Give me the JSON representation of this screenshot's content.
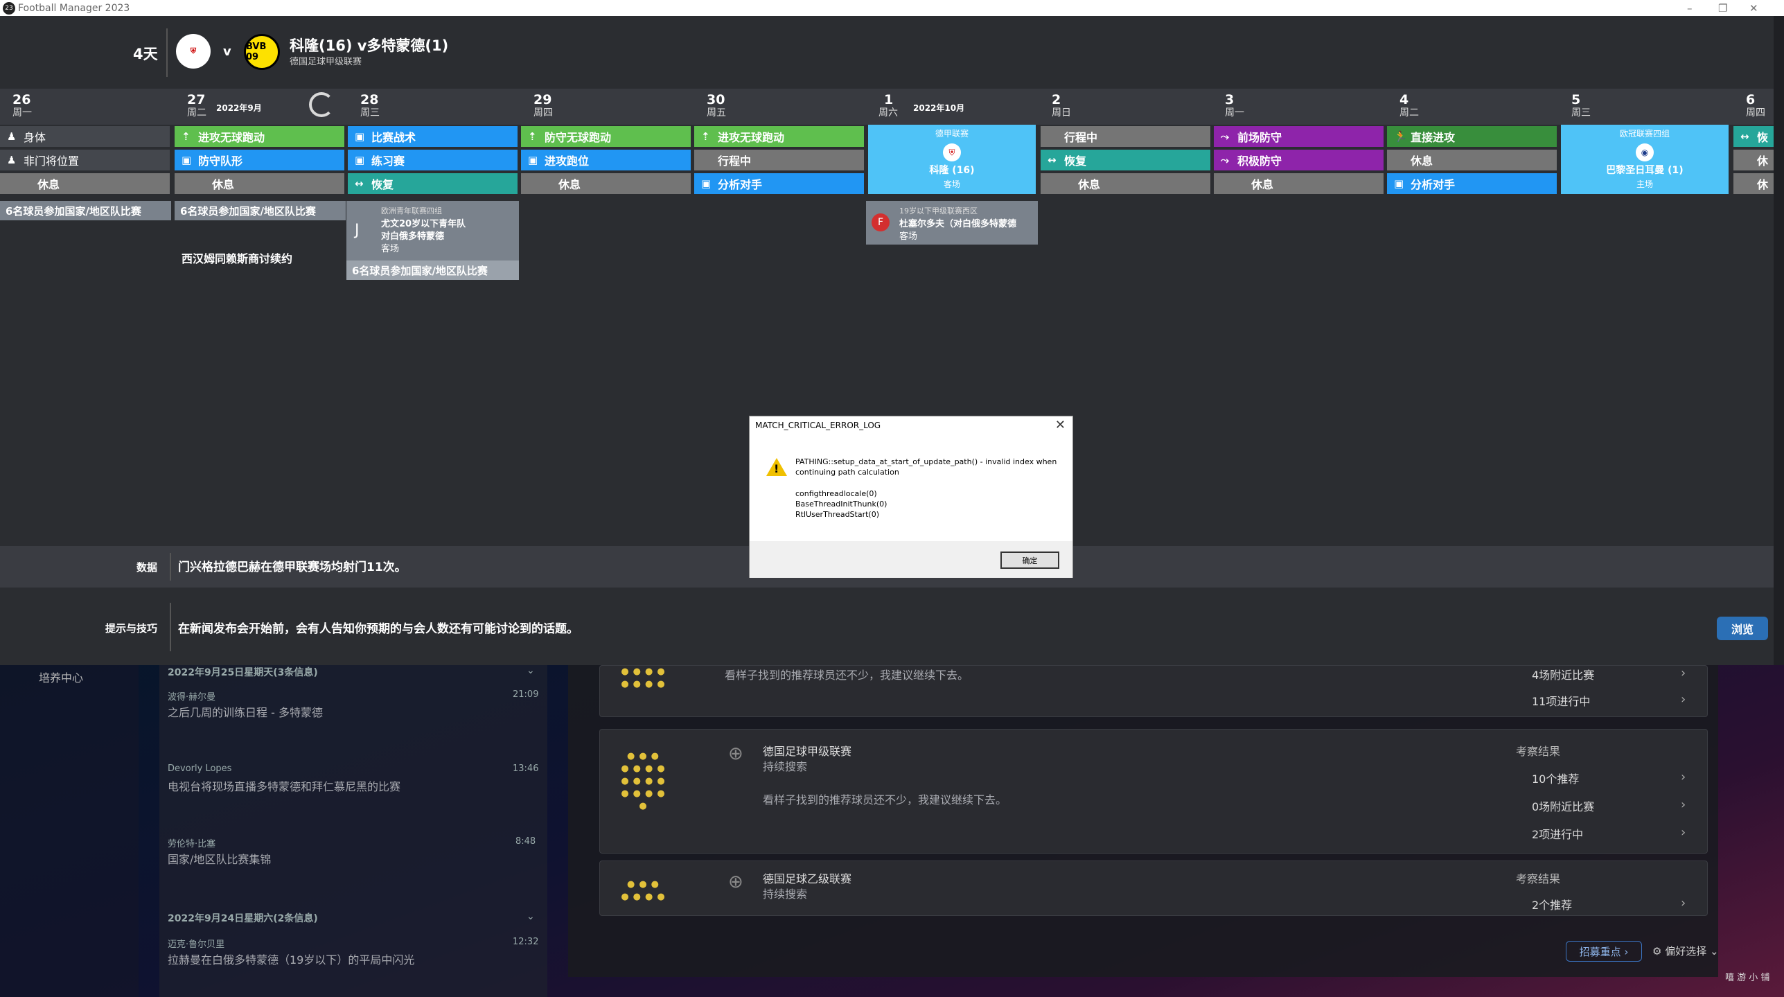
{
  "window": {
    "title": "Football Manager 2023",
    "logo": "23",
    "controls": [
      "–",
      "❐",
      "✕"
    ]
  },
  "match": {
    "days": "4天",
    "vs": "v",
    "title": "科隆(16) v多特蒙德(1)",
    "competition": "德国足球甲级联赛",
    "home_crest": "koln-crest",
    "away_crest": "bvb-crest",
    "away_crest_text": "BVB\n09"
  },
  "calendar": {
    "days": [
      {
        "num": "26",
        "wd": "周一"
      },
      {
        "num": "27",
        "wd": "周二",
        "month": "2022年9月"
      },
      {
        "num": "28",
        "wd": "周三"
      },
      {
        "num": "29",
        "wd": "周四"
      },
      {
        "num": "30",
        "wd": "周五"
      },
      {
        "num": "1",
        "wd": "周六",
        "month": "2022年10月"
      },
      {
        "num": "2",
        "wd": "周日"
      },
      {
        "num": "3",
        "wd": "周一"
      },
      {
        "num": "4",
        "wd": "周二"
      },
      {
        "num": "5",
        "wd": "周三"
      },
      {
        "num": "6",
        "wd": "周四"
      }
    ],
    "sessions": [
      [
        {
          "icon": "person-icon",
          "label": "身体",
          "color": "d"
        },
        {
          "icon": "person-icon",
          "label": "非门将位置",
          "color": "d"
        },
        {
          "icon": "",
          "label": "休息",
          "color": "r"
        }
      ],
      [
        {
          "icon": "arrow-up-icon",
          "label": "进攻无球跑动",
          "color": "g"
        },
        {
          "icon": "board-icon",
          "label": "防守队形",
          "color": "b"
        },
        {
          "icon": "",
          "label": "休息",
          "color": "r"
        }
      ],
      [
        {
          "icon": "board-icon",
          "label": "比赛战术",
          "color": "b"
        },
        {
          "icon": "board-icon",
          "label": "练习赛",
          "color": "b"
        },
        {
          "icon": "arrows-icon",
          "label": "恢复",
          "color": "t"
        }
      ],
      [
        {
          "icon": "arrow-up-icon",
          "label": "防守无球跑动",
          "color": "g"
        },
        {
          "icon": "board-icon",
          "label": "进攻跑位",
          "color": "b"
        },
        {
          "icon": "",
          "label": "休息",
          "color": "r"
        }
      ],
      [
        {
          "icon": "arrow-up-icon",
          "label": "进攻无球跑动",
          "color": "g"
        },
        {
          "icon": "",
          "label": "行程中",
          "color": "r"
        },
        {
          "icon": "board-icon",
          "label": "分析对手",
          "color": "b"
        }
      ],
      null,
      [
        {
          "icon": "",
          "label": "行程中",
          "color": "r"
        },
        {
          "icon": "arrows-icon",
          "label": "恢复",
          "color": "t"
        },
        {
          "icon": "",
          "label": "休息",
          "color": "r"
        }
      ],
      [
        {
          "icon": "defend-icon",
          "label": "前场防守",
          "color": "p"
        },
        {
          "icon": "defend-icon",
          "label": "积极防守",
          "color": "p"
        },
        {
          "icon": "",
          "label": "休息",
          "color": "r"
        }
      ],
      [
        {
          "icon": "run-icon",
          "label": "直接进攻",
          "color": "dg"
        },
        {
          "icon": "",
          "label": "休息",
          "color": "r"
        },
        {
          "icon": "board-icon",
          "label": "分析对手",
          "color": "b"
        }
      ],
      null,
      [
        {
          "icon": "arrows-icon",
          "label": "恢",
          "color": "t"
        },
        {
          "icon": "",
          "label": "休",
          "color": "r"
        },
        {
          "icon": "",
          "label": "休",
          "color": "r"
        }
      ]
    ],
    "matches": {
      "sat": {
        "league": "德甲联赛",
        "team": "科隆 (16)",
        "venue": "客场"
      },
      "wed": {
        "league": "欧冠联赛四组",
        "team": "巴黎圣日耳曼 (1)",
        "venue": "主场"
      }
    },
    "events": {
      "intl1": "6名球员参加国家/地区队比赛",
      "intl2": "6名球员参加国家/地区队比赛",
      "intl3": "6名球员参加国家/地区队比赛",
      "contract": "西汉姆同赖斯商讨续约",
      "youth": {
        "league": "欧洲青年联赛四组",
        "team": "尤文20岁以下青年队",
        "opp": "对白俄多特蒙德",
        "venue": "客场"
      },
      "u19": {
        "league": "19岁以下甲级联赛西区",
        "team": "杜塞尔多夫（对白俄多特蒙德",
        "venue": "客场"
      }
    }
  },
  "info": {
    "data_label": "数据",
    "data_text": "门兴格拉德巴赫在德甲联赛场均射门11次。",
    "tips_label": "提示与技巧",
    "tips_text": "在新闻发布会开始前，会有人告知你预期的与会人数还有可能讨论到的话题。",
    "browse": "浏览"
  },
  "background": {
    "sidebar_item": "培养中心",
    "news": [
      {
        "header": "2022年9月25日星期天(3条信息)"
      },
      {
        "from": "波得·赫尔曼",
        "time": "21:09",
        "title": "之后几周的训练日程 - 多特蒙德"
      },
      {
        "from": "Devorly Lopes",
        "time": "13:46",
        "title": "电视台将现场直播多特蒙德和拜仁慕尼黑的比赛"
      },
      {
        "from": "劳伦特·比塞",
        "time": "8:48",
        "title": "国家/地区队比赛集锦"
      },
      {
        "header": "2022年9月24日星期六(2条信息)"
      },
      {
        "from": "迈克·鲁尔贝里",
        "time": "12:32",
        "title": "拉赫曼在白俄多特蒙德（19岁以下）的平局中闪光"
      }
    ],
    "scout": [
      {
        "text": "看样子找到的推荐球员还不少，我建议继续下去。",
        "r1": "4场附近比赛",
        "r2": "11项进行中"
      },
      {
        "league": "德国足球甲级联赛",
        "status": "持续搜索",
        "text": "看样子找到的推荐球员还不少，我建议继续下去。",
        "rh": "考察结果",
        "r1": "10个推荐",
        "r2": "0场附近比赛",
        "r3": "2项进行中"
      },
      {
        "league": "德国足球乙级联赛",
        "status": "持续搜索",
        "rh": "考察结果",
        "r1": "2个推荐"
      }
    ],
    "footer": {
      "recruit": "招募重点 ›",
      "prefs": "⚙ 偏好选择 ⌄",
      "watermark": "嘻 游 小 铺"
    }
  },
  "dialog": {
    "title": "MATCH_CRITICAL_ERROR_LOG",
    "close": "✕",
    "message": "PATHING::setup_data_at_start_of_update_path() - invalid index when continuing path calculation",
    "stack": [
      "configthreadlocale(0)",
      "BaseThreadInitThunk(0)",
      "RtlUserThreadStart(0)"
    ],
    "ok": "确定"
  }
}
